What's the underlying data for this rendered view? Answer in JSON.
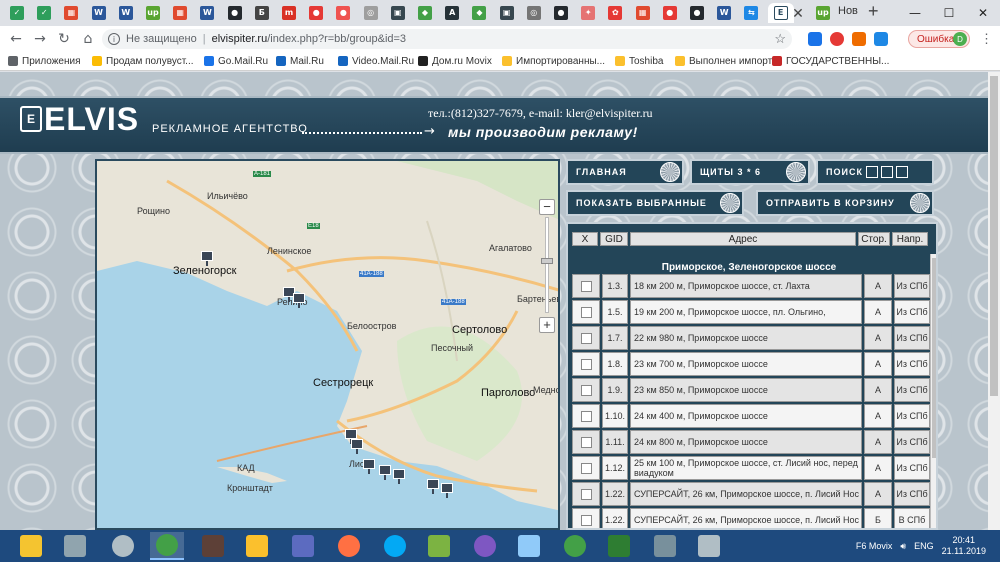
{
  "browser": {
    "tabs": [
      {
        "icon": "check-icon",
        "color": "#2e9e5b",
        "glyph": "✓"
      },
      {
        "icon": "check-icon",
        "color": "#2e9e5b",
        "glyph": "✓"
      },
      {
        "icon": "windows-icon",
        "color": "#e04a2f",
        "glyph": "▦"
      },
      {
        "icon": "word-icon",
        "color": "#2b579a",
        "glyph": "W"
      },
      {
        "icon": "word-icon",
        "color": "#2b579a",
        "glyph": "W"
      },
      {
        "icon": "up-icon",
        "color": "#5aa532",
        "glyph": "up"
      },
      {
        "icon": "windows-icon",
        "color": "#e04a2f",
        "glyph": "▦"
      },
      {
        "icon": "word-icon",
        "color": "#2b579a",
        "glyph": "W"
      },
      {
        "icon": "github-icon",
        "color": "#24292e",
        "glyph": "●"
      },
      {
        "icon": "b-icon",
        "color": "#444444",
        "glyph": "Б"
      },
      {
        "icon": "mail-icon",
        "color": "#d93025",
        "glyph": "m"
      },
      {
        "icon": "record-icon",
        "color": "#e53935",
        "glyph": "●"
      },
      {
        "icon": "record-icon",
        "color": "#ef5350",
        "glyph": "●"
      },
      {
        "icon": "globe-icon",
        "color": "#9e9e9e",
        "glyph": "◎"
      },
      {
        "icon": "terminal-icon",
        "color": "#37474f",
        "glyph": "▣"
      },
      {
        "icon": "leaf-icon",
        "color": "#43a047",
        "glyph": "◆"
      },
      {
        "icon": "a-icon",
        "color": "#263238",
        "glyph": "A"
      },
      {
        "icon": "leaf-icon",
        "color": "#43a047",
        "glyph": "◆"
      },
      {
        "icon": "terminal-icon",
        "color": "#37474f",
        "glyph": "▣"
      },
      {
        "icon": "globe-icon",
        "color": "#757575",
        "glyph": "◎"
      },
      {
        "icon": "github-icon",
        "color": "#24292e",
        "glyph": "●"
      },
      {
        "icon": "puzzle-icon",
        "color": "#e57373",
        "glyph": "✦"
      },
      {
        "icon": "gear-icon",
        "color": "#e53935",
        "glyph": "✿"
      },
      {
        "icon": "windows-icon",
        "color": "#e04a2f",
        "glyph": "▦"
      },
      {
        "icon": "record-icon",
        "color": "#e53935",
        "glyph": "●"
      },
      {
        "icon": "github-icon",
        "color": "#24292e",
        "glyph": "●"
      },
      {
        "icon": "word-icon",
        "color": "#2b579a",
        "glyph": "W"
      },
      {
        "icon": "link-icon",
        "color": "#1e88e5",
        "glyph": "⇆"
      },
      {
        "icon": "elvis-icon",
        "color": "#ffffff",
        "glyph": "E"
      }
    ],
    "extra_tab_icon": "up-icon",
    "extra_tab_title": "Нов",
    "close_glyph": "✕",
    "newtab_glyph": "+",
    "win_min": "—",
    "win_max": "☐",
    "win_close": "✕",
    "back": "←",
    "forward": "→",
    "reload": "↻",
    "home": "⌂",
    "secure_label": "Не защищено",
    "url_host": "elvispiter.ru",
    "url_path": "/index.php?r=bb/group&id=3",
    "star": "☆",
    "error_label": "Ошибка",
    "avatar_letter": "D",
    "menu": "⋮",
    "bookmarks": [
      {
        "label": "Приложения",
        "color": "#5f6368"
      },
      {
        "label": "Продам полувуст...",
        "color": "#fbbc05"
      },
      {
        "label": "Go.Mail.Ru",
        "color": "#1a73e8"
      },
      {
        "label": "Mail.Ru",
        "color": "#1565c0"
      },
      {
        "label": "Video.Mail.Ru",
        "color": "#1565c0"
      },
      {
        "label": "Дом.ru Movix",
        "color": "#212121"
      },
      {
        "label": "Импортированны...",
        "color": "#fbc02d"
      },
      {
        "label": "Toshiba",
        "color": "#fbc02d"
      },
      {
        "label": "Выполнен импорт",
        "color": "#fbc02d"
      },
      {
        "label": "ГОСУДАРСТВЕННЫ...",
        "color": "#c62828"
      }
    ]
  },
  "site": {
    "logo": "ELVIS",
    "logo_mark": "E",
    "logo_sub": "РЕКЛАМНОЕ АГЕНТСТВО",
    "contact": "тел.:(812)327-7679, e-mail: kler@elvispiter.ru",
    "arrow": "→",
    "slogan": "мы производим рекламу!",
    "nav": {
      "home": "ГЛАВНАЯ",
      "boards": "ЩИТЫ 3 * 6",
      "search": "ПОИСК",
      "show_selected": "ПОКАЗАТЬ ВЫБРАННЫЕ",
      "send_cart": "ОТПРАВИТЬ В КОРЗИНУ"
    }
  },
  "map": {
    "labels": [
      {
        "text": "Ильичёво",
        "cls": ""
      },
      {
        "text": "Рощино",
        "cls": ""
      },
      {
        "text": "Ленинское",
        "cls": ""
      },
      {
        "text": "Агалатово",
        "cls": ""
      },
      {
        "text": "Зеленогорск",
        "cls": "big"
      },
      {
        "text": "Репино",
        "cls": ""
      },
      {
        "text": "Белоостров",
        "cls": ""
      },
      {
        "text": "Сертолово",
        "cls": "big"
      },
      {
        "text": "Песочный",
        "cls": ""
      },
      {
        "text": "Сестрорецк",
        "cls": "big"
      },
      {
        "text": "Парголово",
        "cls": "big"
      },
      {
        "text": "Кронштадт",
        "cls": ""
      },
      {
        "text": "КАД",
        "cls": ""
      },
      {
        "text": "Лис",
        "cls": ""
      },
      {
        "text": "Бартеньев",
        "cls": ""
      },
      {
        "text": "Медное",
        "cls": ""
      }
    ],
    "signs": [
      {
        "text": "A-181",
        "blue": false
      },
      {
        "text": "E18",
        "blue": false
      },
      {
        "text": "41А-188",
        "blue": true
      },
      {
        "text": "41А-188",
        "blue": true
      }
    ],
    "zoom_in": "+",
    "zoom_out": "−"
  },
  "table": {
    "headers": {
      "x": "X",
      "gid": "GID",
      "address": "Адрес",
      "side": "Стор.",
      "dir": "Напр."
    },
    "group": "Приморское, Зеленогорское шоссе",
    "rows": [
      {
        "gid": "1.3.",
        "address": "18 км 200 м, Приморское шоссе, ст. Лахта",
        "side": "А",
        "dir": "Из СПб"
      },
      {
        "gid": "1.5.",
        "address": "19 км 200 м, Приморское шоссе, пл. Ольгино,",
        "side": "А",
        "dir": "Из СПб"
      },
      {
        "gid": "1.7.",
        "address": "22 км 980 м, Приморское шоссе",
        "side": "А",
        "dir": "Из СПб"
      },
      {
        "gid": "1.8.",
        "address": "23 км 700 м, Приморское шоссе",
        "side": "А",
        "dir": "Из СПб"
      },
      {
        "gid": "1.9.",
        "address": "23 км 850 м, Приморское шоссе",
        "side": "А",
        "dir": "Из СПб"
      },
      {
        "gid": "1.10.",
        "address": "24 км 400 м, Приморское шоссе",
        "side": "А",
        "dir": "Из СПб"
      },
      {
        "gid": "1.11.",
        "address": "24 км 800 м, Приморское шоссе",
        "side": "А",
        "dir": "Из СПб"
      },
      {
        "gid": "1.12.",
        "address": "25 км 100 м, Приморское шоссе, ст. Лисий нос, перед виадуком",
        "side": "А",
        "dir": "Из СПб"
      },
      {
        "gid": "1.22.",
        "address": "СУПЕРСАЙТ, 26 км, Приморское шоссе, п. Лисий Нос",
        "side": "А",
        "dir": "Из СПб"
      },
      {
        "gid": "1.22.",
        "address": "СУПЕРСАЙТ, 26 км, Приморское шоссе, п. Лисий Нос",
        "side": "Б",
        "dir": "В СПб"
      }
    ]
  },
  "taskbar": {
    "apps": [
      {
        "icon": "explorer-icon",
        "color": "#f4c430"
      },
      {
        "icon": "calculator-icon",
        "color": "#90a4ae"
      },
      {
        "icon": "media-icon",
        "color": "#b0bec5"
      },
      {
        "icon": "chrome-icon",
        "color": "#43a047"
      },
      {
        "icon": "tools-icon",
        "color": "#5d4037"
      },
      {
        "icon": "pen-icon",
        "color": "#fbc02d"
      },
      {
        "icon": "save-icon",
        "color": "#5c6bc0"
      },
      {
        "icon": "firefox-icon",
        "color": "#ff7043"
      },
      {
        "icon": "skype-icon",
        "color": "#03a9f4"
      },
      {
        "icon": "chart-app-icon",
        "color": "#7cb342"
      },
      {
        "icon": "tor-icon",
        "color": "#7e57c2"
      },
      {
        "icon": "virtualbox-icon",
        "color": "#90caf9"
      },
      {
        "icon": "chrome-icon",
        "color": "#43a047"
      },
      {
        "icon": "excel-icon",
        "color": "#2e7d32"
      },
      {
        "icon": "display-icon",
        "color": "#78909c"
      },
      {
        "icon": "tasks-icon",
        "color": "#b0bec5"
      }
    ],
    "tray_label": "F6 Movix",
    "lang": "ENG",
    "time": "20:41",
    "date": "21.11.2019"
  }
}
